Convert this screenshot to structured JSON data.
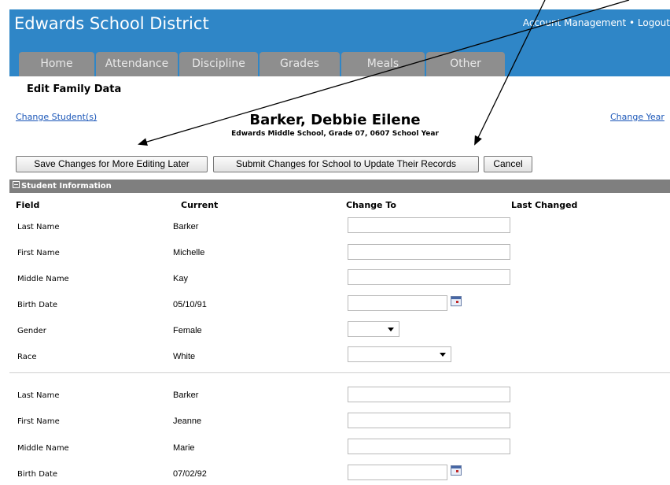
{
  "app": {
    "title": "Edwards School District",
    "account_management": "Account Management",
    "separator": "•",
    "logout": "Logout"
  },
  "tabs": [
    {
      "label": "Home"
    },
    {
      "label": "Attendance"
    },
    {
      "label": "Discipline"
    },
    {
      "label": "Grades"
    },
    {
      "label": "Meals"
    },
    {
      "label": "Other"
    }
  ],
  "page": {
    "subtitle": "Edit Family Data",
    "change_students": "Change Student(s)",
    "change_year": "Change Year",
    "student_name": "Barker, Debbie Eilene",
    "student_info": "Edwards Middle School, Grade 07, 0607 School Year"
  },
  "buttons": {
    "save": "Save Changes for More Editing Later",
    "submit": "Submit Changes for School to Update Their Records",
    "cancel": "Cancel"
  },
  "section": {
    "title": "Student Information",
    "columns": {
      "field": "Field",
      "current": "Current",
      "change_to": "Change To",
      "last_changed": "Last Changed"
    }
  },
  "group1": [
    {
      "field": "Last Name",
      "current": "Barker"
    },
    {
      "field": "First Name",
      "current": "Michelle"
    },
    {
      "field": "Middle Name",
      "current": "Kay"
    },
    {
      "field": "Birth Date",
      "current": "05/10/91"
    },
    {
      "field": "Gender",
      "current": "Female"
    },
    {
      "field": "Race",
      "current": "White"
    }
  ],
  "group2": [
    {
      "field": "Last Name",
      "current": "Barker"
    },
    {
      "field": "First Name",
      "current": "Jeanne"
    },
    {
      "field": "Middle Name",
      "current": "Marie"
    },
    {
      "field": "Birth Date",
      "current": "07/02/92"
    }
  ],
  "icons": {
    "calendar": "calendar-icon",
    "dropdown": "chevron-down-icon",
    "collapse": "minus-box-icon"
  },
  "colors": {
    "header_blue": "#2f86c7",
    "tab_gray": "#8e8e8e",
    "section_gray": "#7f7f7f",
    "link_blue": "#1a56b8"
  }
}
